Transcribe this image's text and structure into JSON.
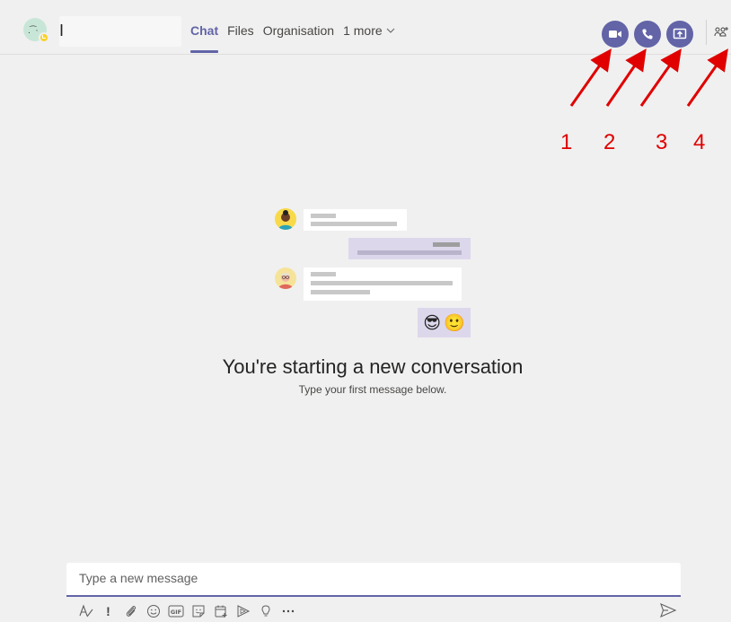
{
  "header": {
    "contact_name": "I",
    "tabs": [
      {
        "label": "Chat",
        "active": true
      },
      {
        "label": "Files",
        "active": false
      },
      {
        "label": "Organisation",
        "active": false
      },
      {
        "label": "1 more",
        "active": false
      }
    ],
    "actions": [
      {
        "icon": "video-call-icon",
        "label": "Video call"
      },
      {
        "icon": "audio-call-icon",
        "label": "Audio call"
      },
      {
        "icon": "share-screen-icon",
        "label": "Share screen"
      },
      {
        "icon": "add-people-icon",
        "label": "Add people"
      }
    ],
    "accent_color": "#6264a7"
  },
  "annotations": {
    "color": "#e00000",
    "numbers": [
      "1",
      "2",
      "3",
      "4"
    ]
  },
  "empty_state": {
    "title": "You're starting a new conversation",
    "subtitle": "Type your first message below.",
    "emojis": [
      "😎",
      "🙂"
    ]
  },
  "composer": {
    "placeholder": "Type a new message",
    "value": "",
    "tools": [
      "format-icon",
      "important-icon",
      "attach-icon",
      "emoji-icon",
      "gif-icon",
      "sticker-icon",
      "schedule-meeting-icon",
      "stream-icon",
      "praise-icon",
      "more-options-icon"
    ],
    "send_icon": "send-icon"
  }
}
